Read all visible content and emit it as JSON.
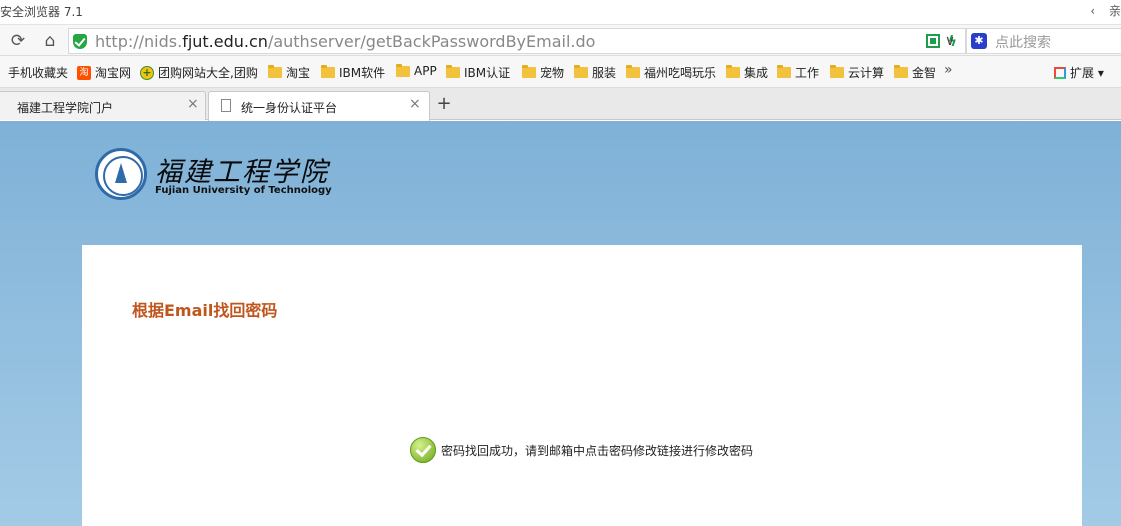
{
  "window": {
    "title": "安全浏览器 7.1",
    "controls": [
      "‹",
      "亲"
    ]
  },
  "toolbar": {
    "refresh_icon": "refresh-icon",
    "home_icon": "home-icon",
    "url_prefix": "http://nids.",
    "url_host": "fjut.edu.cn",
    "url_path": "/authserver/getBackPasswordByEmail.do",
    "dropdown_icon": "chevron-down-icon",
    "search_placeholder": "点此搜索"
  },
  "bookmarks": {
    "items": [
      {
        "label": "手机收藏夹",
        "icon": "none"
      },
      {
        "label": "淘宝网",
        "icon": "taobao-icon",
        "glyph": "淘"
      },
      {
        "label": "团购网站大全,团购",
        "icon": "tuan-icon",
        "glyph": "+"
      },
      {
        "label": "淘宝",
        "icon": "folder-icon"
      },
      {
        "label": "IBM软件",
        "icon": "folder-icon"
      },
      {
        "label": "APP",
        "icon": "folder-icon"
      },
      {
        "label": "IBM认证",
        "icon": "folder-icon"
      },
      {
        "label": "宠物",
        "icon": "folder-icon"
      },
      {
        "label": "服装",
        "icon": "folder-icon"
      },
      {
        "label": "福州吃喝玩乐",
        "icon": "folder-icon"
      },
      {
        "label": "集成",
        "icon": "folder-icon"
      },
      {
        "label": "工作",
        "icon": "folder-icon"
      },
      {
        "label": "云计算",
        "icon": "folder-icon"
      },
      {
        "label": "金智",
        "icon": "folder-icon"
      }
    ],
    "more": "»",
    "extensions_label": "扩展"
  },
  "tabs": [
    {
      "label": "福建工程学院门户",
      "active": false
    },
    {
      "label": "统一身份认证平台",
      "active": true
    }
  ],
  "tab_close": "×",
  "new_tab": "+",
  "page": {
    "logo_cn": "福建工程学院",
    "logo_en": "Fujian University of Technology",
    "card_title": "根据Email找回密码",
    "success_message": "密码找回成功，请到邮箱中点击密码修改链接进行修改密码"
  },
  "colors": {
    "page_bg": "#7fb1d7",
    "title_accent": "#c0561d",
    "secure_green": "#27a744"
  }
}
